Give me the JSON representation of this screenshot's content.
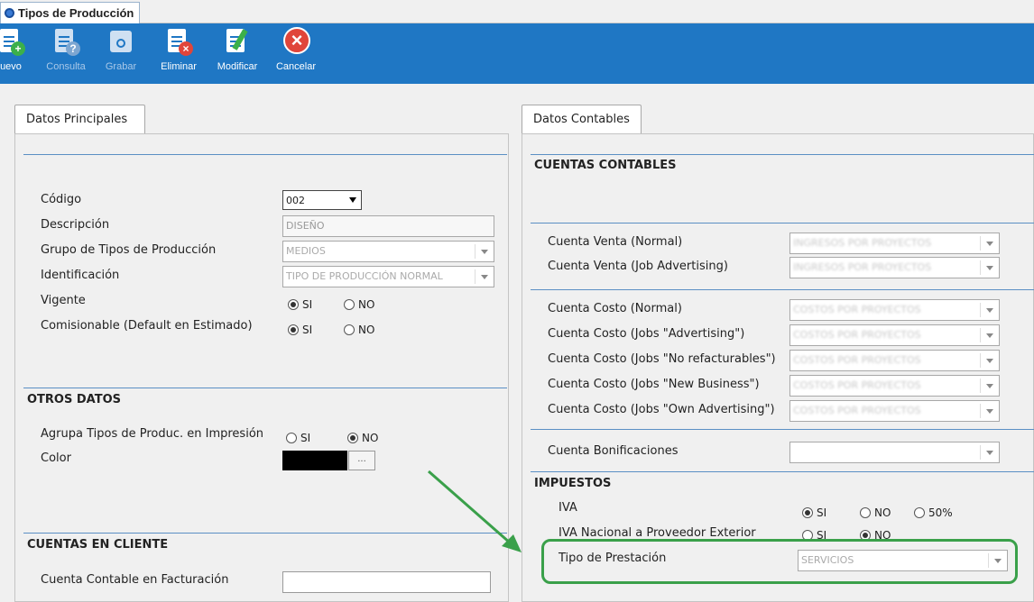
{
  "window": {
    "title": "Tipos de Producción"
  },
  "toolbar": {
    "nuevo": "uevo",
    "consulta": "Consulta",
    "grabar": "Grabar",
    "eliminar": "Eliminar",
    "modificar": "Modificar",
    "cancelar": "Cancelar"
  },
  "left": {
    "tab": "Datos Principales",
    "codigo_label": "Código",
    "codigo_value": "002",
    "descripcion_label": "Descripción",
    "descripcion_value": "DISEÑO",
    "grupo_label": "Grupo de Tipos de Producción",
    "grupo_value": "MEDIOS",
    "identificacion_label": "Identificación",
    "identificacion_value": "TIPO DE PRODUCCIÓN NORMAL",
    "vigente_label": "Vigente",
    "comisionable_label": "Comisionable (Default en Estimado)",
    "si": "SI",
    "no": "NO",
    "otros_title": "OTROS DATOS",
    "agrupa_label": "Agrupa Tipos de Produc. en Impresión",
    "color_label": "Color",
    "color_btn": "...",
    "cuentas_cliente_title": "CUENTAS EN CLIENTE",
    "cuenta_facturacion_label": "Cuenta Contable en Facturación"
  },
  "right": {
    "tab": "Datos Contables",
    "cuentas_title": "CUENTAS CONTABLES",
    "venta_normal": "Cuenta Venta (Normal)",
    "venta_job": "Cuenta Venta (Job Advertising)",
    "costo_normal": "Cuenta Costo (Normal)",
    "costo_adv": "Cuenta Costo (Jobs \"Advertising\")",
    "costo_nore": "Cuenta Costo (Jobs \"No refacturables\")",
    "costo_newb": "Cuenta Costo (Jobs \"New Business\")",
    "costo_own": "Cuenta Costo (Jobs \"Own Advertising\")",
    "bonificaciones": "Cuenta Bonificaciones",
    "impuestos_title": "IMPUESTOS",
    "iva_label": "IVA",
    "iva_si": "SI",
    "iva_no": "NO",
    "iva_50": "50%",
    "iva_nac_label": "IVA Nacional a Proveedor Exterior",
    "iva_nac_si": "SI",
    "iva_nac_no": "NO",
    "prestacion_label": "Tipo de Prestación",
    "prestacion_value": "SERVICIOS",
    "blur_venta": "INGRESOS POR PROYECTOS",
    "blur_costo": "COSTOS POR PROYECTOS"
  },
  "colors": {
    "toolbar": "#1f77c4",
    "highlight": "#3aa04a",
    "section_line": "#5b8fc4"
  }
}
